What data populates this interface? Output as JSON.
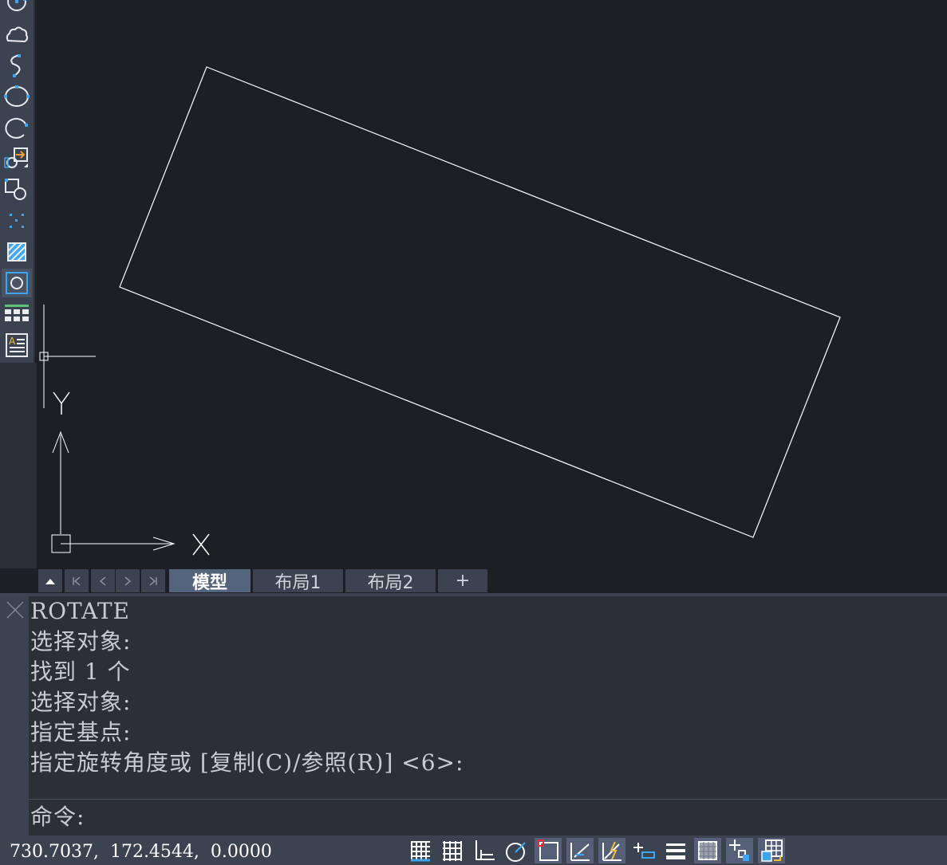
{
  "toolbar": {
    "tools": [
      "circle-center-icon",
      "revision-cloud-icon",
      "spline-icon",
      "ellipse-icon",
      "ellipse-arc-icon",
      "insert-block-icon",
      "make-block-icon",
      "point-icon",
      "hatch-icon",
      "region-icon",
      "table-icon",
      "multiline-text-icon"
    ],
    "active_tool": "region-icon"
  },
  "canvas": {
    "background": "#1c1f24",
    "ucs_labels": {
      "x": "X",
      "y": "Y"
    }
  },
  "tabs": {
    "items": [
      {
        "label": "模型",
        "active": true
      },
      {
        "label": "布局1",
        "active": false
      },
      {
        "label": "布局2",
        "active": false
      }
    ],
    "add_label": "+"
  },
  "command": {
    "history": [
      "ROTATE",
      "选择对象:",
      "找到 1 个",
      "选择对象:",
      "指定基点:",
      "指定旋转角度或 [复制(C)/参照(R)] <6>:"
    ],
    "prompt": "命令:"
  },
  "status": {
    "coordinates": "730.7037,  172.4544,  0.0000",
    "toggles": [
      {
        "name": "grid-display-icon",
        "on": false
      },
      {
        "name": "snap-mode-icon",
        "on": false
      },
      {
        "name": "ortho-mode-icon",
        "on": false
      },
      {
        "name": "polar-tracking-icon",
        "on": false
      },
      {
        "name": "object-snap-icon",
        "on": true
      },
      {
        "name": "object-snap-tracking-icon",
        "on": true
      },
      {
        "name": "dynamic-ucs-icon",
        "on": true
      },
      {
        "name": "dynamic-input-icon",
        "on": false
      },
      {
        "name": "lineweight-icon",
        "on": false
      },
      {
        "name": "transparency-icon",
        "on": true
      },
      {
        "name": "selection-cycling-icon",
        "on": true
      },
      {
        "name": "annotation-monitor-icon",
        "on": true
      }
    ],
    "accent": "#3ea6f0"
  }
}
